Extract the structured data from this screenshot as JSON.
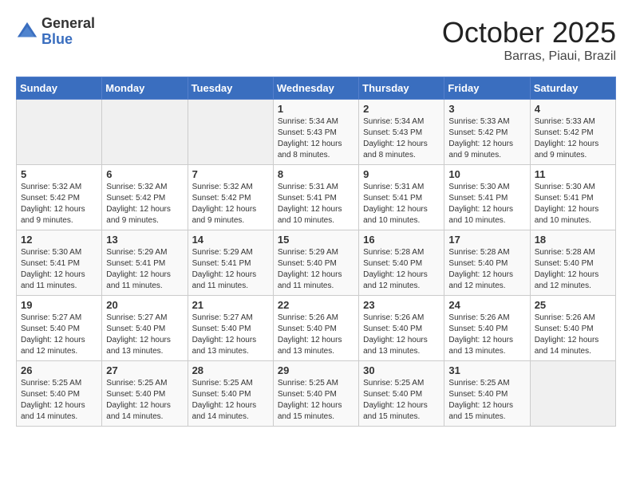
{
  "logo": {
    "general": "General",
    "blue": "Blue"
  },
  "title": "October 2025",
  "location": "Barras, Piaui, Brazil",
  "days_header": [
    "Sunday",
    "Monday",
    "Tuesday",
    "Wednesday",
    "Thursday",
    "Friday",
    "Saturday"
  ],
  "weeks": [
    [
      {
        "day": "",
        "info": ""
      },
      {
        "day": "",
        "info": ""
      },
      {
        "day": "",
        "info": ""
      },
      {
        "day": "1",
        "info": "Sunrise: 5:34 AM\nSunset: 5:43 PM\nDaylight: 12 hours\nand 8 minutes."
      },
      {
        "day": "2",
        "info": "Sunrise: 5:34 AM\nSunset: 5:43 PM\nDaylight: 12 hours\nand 8 minutes."
      },
      {
        "day": "3",
        "info": "Sunrise: 5:33 AM\nSunset: 5:42 PM\nDaylight: 12 hours\nand 9 minutes."
      },
      {
        "day": "4",
        "info": "Sunrise: 5:33 AM\nSunset: 5:42 PM\nDaylight: 12 hours\nand 9 minutes."
      }
    ],
    [
      {
        "day": "5",
        "info": "Sunrise: 5:32 AM\nSunset: 5:42 PM\nDaylight: 12 hours\nand 9 minutes."
      },
      {
        "day": "6",
        "info": "Sunrise: 5:32 AM\nSunset: 5:42 PM\nDaylight: 12 hours\nand 9 minutes."
      },
      {
        "day": "7",
        "info": "Sunrise: 5:32 AM\nSunset: 5:42 PM\nDaylight: 12 hours\nand 9 minutes."
      },
      {
        "day": "8",
        "info": "Sunrise: 5:31 AM\nSunset: 5:41 PM\nDaylight: 12 hours\nand 10 minutes."
      },
      {
        "day": "9",
        "info": "Sunrise: 5:31 AM\nSunset: 5:41 PM\nDaylight: 12 hours\nand 10 minutes."
      },
      {
        "day": "10",
        "info": "Sunrise: 5:30 AM\nSunset: 5:41 PM\nDaylight: 12 hours\nand 10 minutes."
      },
      {
        "day": "11",
        "info": "Sunrise: 5:30 AM\nSunset: 5:41 PM\nDaylight: 12 hours\nand 10 minutes."
      }
    ],
    [
      {
        "day": "12",
        "info": "Sunrise: 5:30 AM\nSunset: 5:41 PM\nDaylight: 12 hours\nand 11 minutes."
      },
      {
        "day": "13",
        "info": "Sunrise: 5:29 AM\nSunset: 5:41 PM\nDaylight: 12 hours\nand 11 minutes."
      },
      {
        "day": "14",
        "info": "Sunrise: 5:29 AM\nSunset: 5:41 PM\nDaylight: 12 hours\nand 11 minutes."
      },
      {
        "day": "15",
        "info": "Sunrise: 5:29 AM\nSunset: 5:40 PM\nDaylight: 12 hours\nand 11 minutes."
      },
      {
        "day": "16",
        "info": "Sunrise: 5:28 AM\nSunset: 5:40 PM\nDaylight: 12 hours\nand 12 minutes."
      },
      {
        "day": "17",
        "info": "Sunrise: 5:28 AM\nSunset: 5:40 PM\nDaylight: 12 hours\nand 12 minutes."
      },
      {
        "day": "18",
        "info": "Sunrise: 5:28 AM\nSunset: 5:40 PM\nDaylight: 12 hours\nand 12 minutes."
      }
    ],
    [
      {
        "day": "19",
        "info": "Sunrise: 5:27 AM\nSunset: 5:40 PM\nDaylight: 12 hours\nand 12 minutes."
      },
      {
        "day": "20",
        "info": "Sunrise: 5:27 AM\nSunset: 5:40 PM\nDaylight: 12 hours\nand 13 minutes."
      },
      {
        "day": "21",
        "info": "Sunrise: 5:27 AM\nSunset: 5:40 PM\nDaylight: 12 hours\nand 13 minutes."
      },
      {
        "day": "22",
        "info": "Sunrise: 5:26 AM\nSunset: 5:40 PM\nDaylight: 12 hours\nand 13 minutes."
      },
      {
        "day": "23",
        "info": "Sunrise: 5:26 AM\nSunset: 5:40 PM\nDaylight: 12 hours\nand 13 minutes."
      },
      {
        "day": "24",
        "info": "Sunrise: 5:26 AM\nSunset: 5:40 PM\nDaylight: 12 hours\nand 13 minutes."
      },
      {
        "day": "25",
        "info": "Sunrise: 5:26 AM\nSunset: 5:40 PM\nDaylight: 12 hours\nand 14 minutes."
      }
    ],
    [
      {
        "day": "26",
        "info": "Sunrise: 5:25 AM\nSunset: 5:40 PM\nDaylight: 12 hours\nand 14 minutes."
      },
      {
        "day": "27",
        "info": "Sunrise: 5:25 AM\nSunset: 5:40 PM\nDaylight: 12 hours\nand 14 minutes."
      },
      {
        "day": "28",
        "info": "Sunrise: 5:25 AM\nSunset: 5:40 PM\nDaylight: 12 hours\nand 14 minutes."
      },
      {
        "day": "29",
        "info": "Sunrise: 5:25 AM\nSunset: 5:40 PM\nDaylight: 12 hours\nand 15 minutes."
      },
      {
        "day": "30",
        "info": "Sunrise: 5:25 AM\nSunset: 5:40 PM\nDaylight: 12 hours\nand 15 minutes."
      },
      {
        "day": "31",
        "info": "Sunrise: 5:25 AM\nSunset: 5:40 PM\nDaylight: 12 hours\nand 15 minutes."
      },
      {
        "day": "",
        "info": ""
      }
    ]
  ]
}
